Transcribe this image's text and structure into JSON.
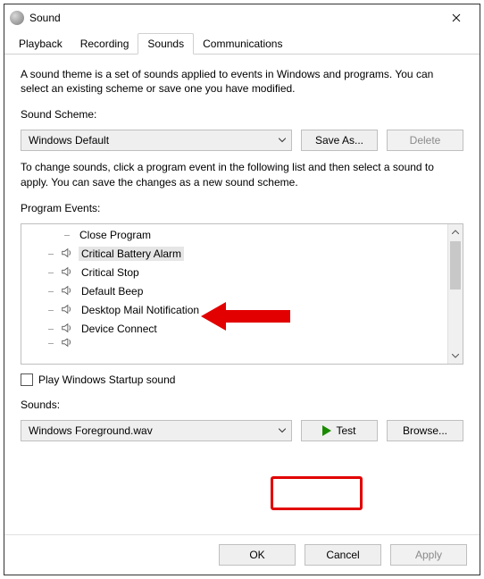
{
  "window": {
    "title": "Sound"
  },
  "tabs": [
    {
      "label": "Playback"
    },
    {
      "label": "Recording"
    },
    {
      "label": "Sounds"
    },
    {
      "label": "Communications"
    }
  ],
  "description": "A sound theme is a set of sounds applied to events in Windows and programs.  You can select an existing scheme or save one you have modified.",
  "scheme": {
    "label": "Sound Scheme:",
    "selected": "Windows Default",
    "save_as": "Save As...",
    "delete": "Delete"
  },
  "change_hint": "To change sounds, click a program event in the following list and then select a sound to apply.  You can save the changes as a new sound scheme.",
  "events": {
    "label": "Program Events:",
    "items": [
      {
        "label": "Close Program",
        "has_sound": false,
        "selected": false
      },
      {
        "label": "Critical Battery Alarm",
        "has_sound": true,
        "selected": true
      },
      {
        "label": "Critical Stop",
        "has_sound": true,
        "selected": false
      },
      {
        "label": "Default Beep",
        "has_sound": true,
        "selected": false
      },
      {
        "label": "Desktop Mail Notification",
        "has_sound": true,
        "selected": false
      },
      {
        "label": "Device Connect",
        "has_sound": true,
        "selected": false
      }
    ]
  },
  "startup": {
    "label": "Play Windows Startup sound",
    "checked": false
  },
  "sounds": {
    "label": "Sounds:",
    "selected": "Windows Foreground.wav",
    "test": "Test",
    "browse": "Browse..."
  },
  "buttons": {
    "ok": "OK",
    "cancel": "Cancel",
    "apply": "Apply"
  }
}
